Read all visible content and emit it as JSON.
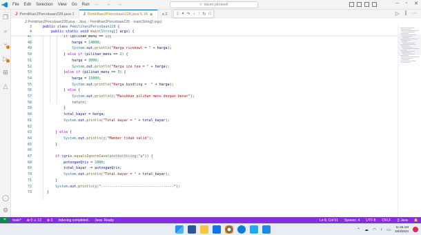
{
  "titlebar": {
    "menu": [
      "File",
      "Edit",
      "Selection",
      "View",
      "Go",
      "Run",
      "···"
    ],
    "search_placeholder": "daum pilotwell"
  },
  "tabs": [
    {
      "label": "Pemilihan2Percobaan228.java 1",
      "active": false
    },
    {
      "label": "Pemilihan2Percobaan228.java 5, M",
      "active": true
    }
  ],
  "tab_extra": "a 2",
  "breadcrumb": [
    "Pemilihan2Percobaan228.java",
    "Java",
    "Pemilihan2Percobaan228",
    "main(String[] args)"
  ],
  "sticky_lines": [
    {
      "n": "3",
      "code": "  public class Pemilihan2Percobaan228 {"
    },
    {
      "n": "4",
      "code": "      public static void main(String[] args) {"
    }
  ],
  "code_lines": [
    {
      "n": "47",
      "code": "            if (pilihan_menu == 1){"
    },
    {
      "n": "48",
      "code": "                harga = 14000;"
    },
    {
      "n": "49",
      "code": "                System.out.println(\"Harga ricebowl = \" + harga);"
    },
    {
      "n": "50",
      "code": "            } else if (pilihan_menu == 2) {"
    },
    {
      "n": "51",
      "code": "                harga = 3000;"
    },
    {
      "n": "52",
      "code": "                System.out.println(\"Harga ice tea = \" + harga);"
    },
    {
      "n": "53",
      "code": "            }else if (pilihan_menu == 3) {"
    },
    {
      "n": "54",
      "code": "                harga = 15000;"
    },
    {
      "n": "55",
      "code": "                System.out.println(\"Harga bundling =  \" + harga);"
    },
    {
      "n": "56",
      "code": "            } else {"
    },
    {
      "n": "57",
      "code": "                System.out.println(x:\"Masukkan pilihan menu dengan benar\");"
    },
    {
      "n": "58",
      "code": "                return;"
    },
    {
      "n": "59",
      "code": "            }"
    },
    {
      "n": "60",
      "code": "            total_bayar = harga;"
    },
    {
      "n": "61",
      "code": "            System.out.println(\"Total bayar = \" + total_bayar);"
    },
    {
      "n": "62",
      "code": ""
    },
    {
      "n": "63",
      "code": "        } else {"
    },
    {
      "n": "64",
      "code": "            System.out.println(x:\"Member tidak valid\");"
    },
    {
      "n": "65",
      "code": "        }"
    },
    {
      "n": "66",
      "code": ""
    },
    {
      "n": "67",
      "code": "        if (qris.equalsIgnoreCase(anotherString:\"y\")) {"
    },
    {
      "n": "68",
      "code": "            potonganQris = 1000;"
    },
    {
      "n": "69",
      "code": "            total_bayar -= potonganQris;"
    },
    {
      "n": "70",
      "code": "            System.out.println(\"Total bayar = \" + total_bayar);"
    },
    {
      "n": "71",
      "code": "        }"
    },
    {
      "n": "72",
      "code": "        System.out.println(x:\"-----------------------------------\");"
    },
    {
      "n": "73",
      "code": "    }"
    }
  ],
  "statusbar": {
    "remote": "main*",
    "errors": "⊗ 0 ⚠ 12",
    "ports": "⊗ 0",
    "indexing": "Indexing completed.",
    "java": "Java: Ready",
    "position": "Ln 8, Col 51",
    "spaces": "Spaces: 4",
    "encoding": "UTF-8",
    "eol": "CRLF",
    "language": "{} Java"
  },
  "taskbar": {
    "time": "11:46 AM",
    "date": "10/3/2024"
  },
  "colors": {
    "status_bg": "#8a2be2",
    "accent": "#0066b8"
  }
}
